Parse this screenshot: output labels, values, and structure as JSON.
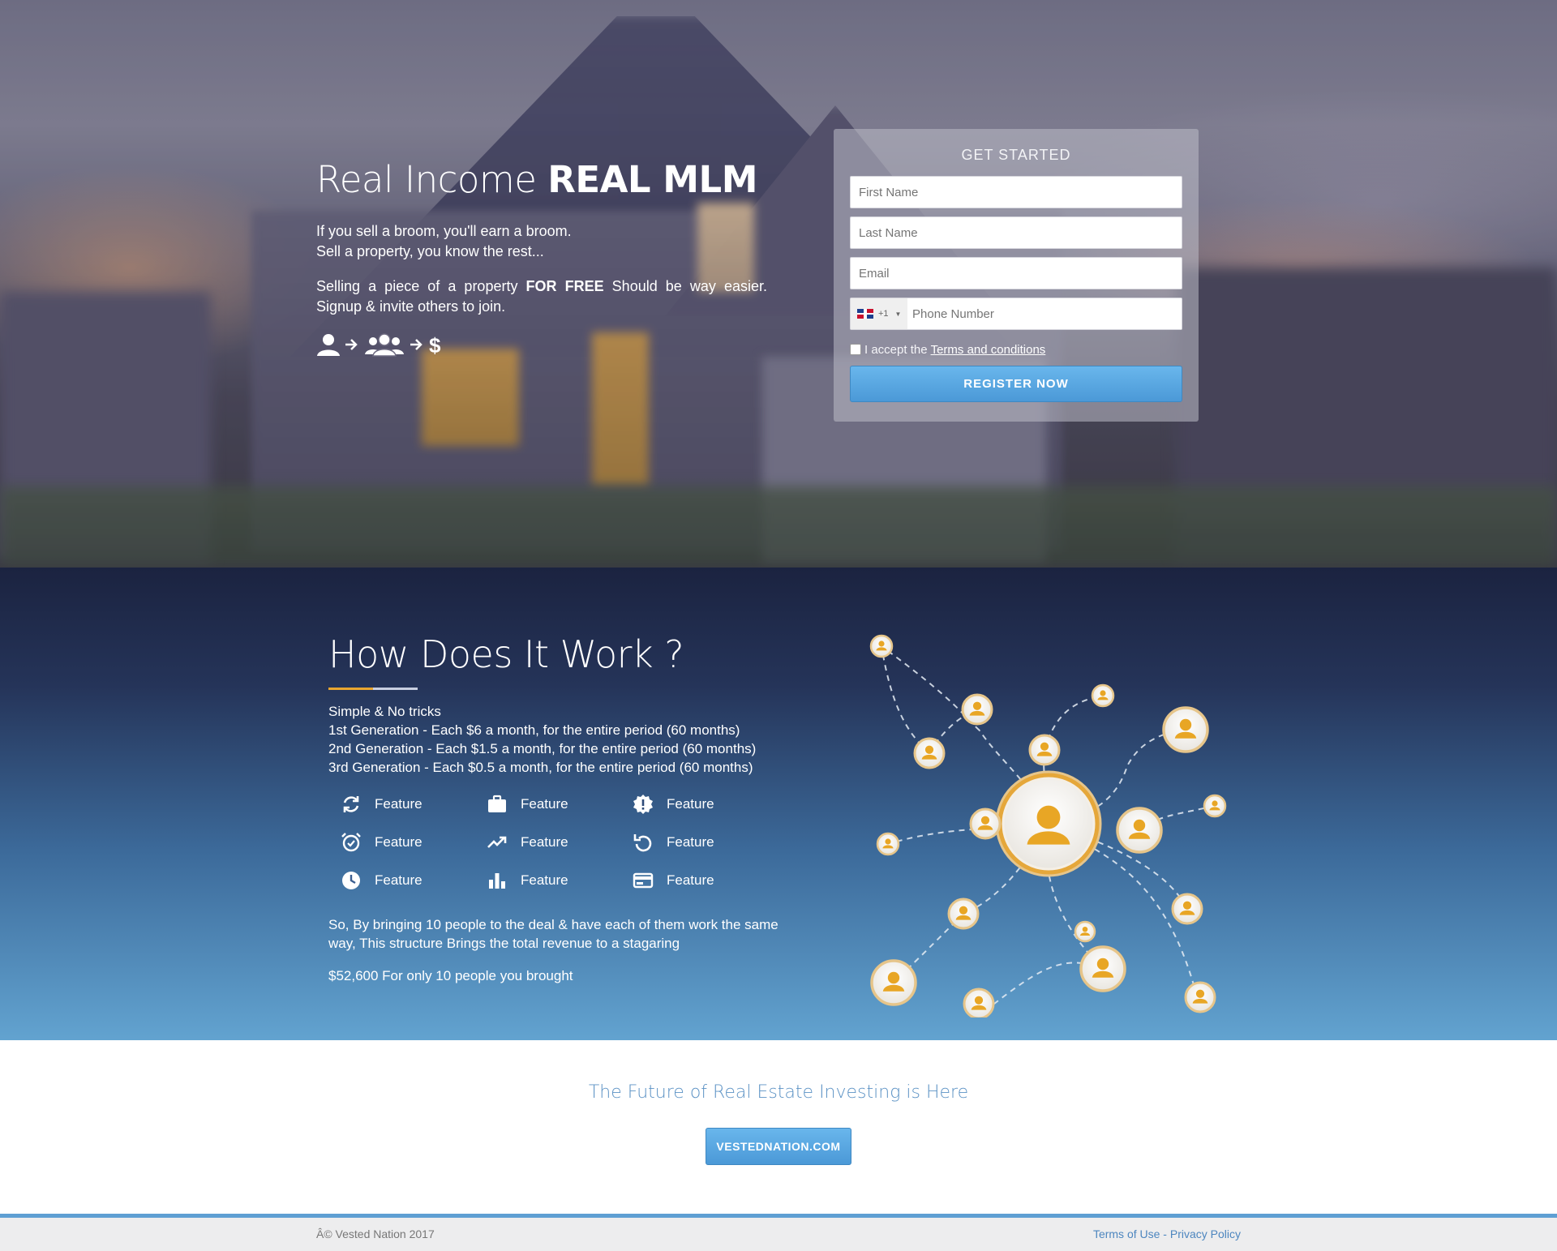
{
  "hero": {
    "title_light": "Real Income ",
    "title_bold": "REAL MLM",
    "line1": "If you sell a broom, you'll earn a broom.",
    "line2": "Sell a property, you know the rest...",
    "p2_before": "Selling a piece of a property ",
    "p2_bold": "FOR FREE",
    "p2_after": " Should be way easier. Signup & invite others to join.",
    "flow_icons": [
      "user-icon",
      "arrow-right-icon",
      "users-icon",
      "arrow-right-icon",
      "dollar-icon"
    ]
  },
  "form": {
    "title": "GET STARTED",
    "first_name_placeholder": "First Name",
    "last_name_placeholder": "Last Name",
    "email_placeholder": "Email",
    "phone_code": "+1",
    "phone_placeholder": "Phone Number",
    "terms_prefix": "I accept the",
    "terms_link": "Terms and conditions",
    "register_label": "REGISTER NOW"
  },
  "how": {
    "title": "How Does It Work ?",
    "lines": [
      "Simple & No tricks",
      "1st Generation - Each $6 a month, for the entire period (60 months)",
      "2nd Generation - Each $1.5 a month, for the entire period (60 months)",
      "3rd Generation - Each $0.5 a month, for the entire period (60 months)"
    ],
    "features": [
      {
        "icon": "refresh-icon",
        "label": "Feature"
      },
      {
        "icon": "briefcase-icon",
        "label": "Feature"
      },
      {
        "icon": "alert-badge-icon",
        "label": "Feature"
      },
      {
        "icon": "alarm-clock-icon",
        "label": "Feature"
      },
      {
        "icon": "trending-up-icon",
        "label": "Feature"
      },
      {
        "icon": "undo-icon",
        "label": "Feature"
      },
      {
        "icon": "clock-icon",
        "label": "Feature"
      },
      {
        "icon": "bar-chart-icon",
        "label": "Feature"
      },
      {
        "icon": "credit-card-icon",
        "label": "Feature"
      }
    ],
    "paragraph": "So, By bringing 10 people to the deal & have each of them work the same way, This structure Brings the total revenue to a stagaring",
    "total": "$52,600 For only 10 people you brought"
  },
  "cta": {
    "title": "The Future of Real Estate Investing is Here",
    "button": "VESTEDNATION.COM"
  },
  "footer": {
    "copyright": "Â© Vested Nation 2017",
    "terms": "Terms of Use",
    "sep": " - ",
    "privacy": "Privacy Policy"
  },
  "colors": {
    "accent_blue": "#4b99d7",
    "accent_gold": "#e9a630",
    "cta_text": "#5d93c5"
  }
}
